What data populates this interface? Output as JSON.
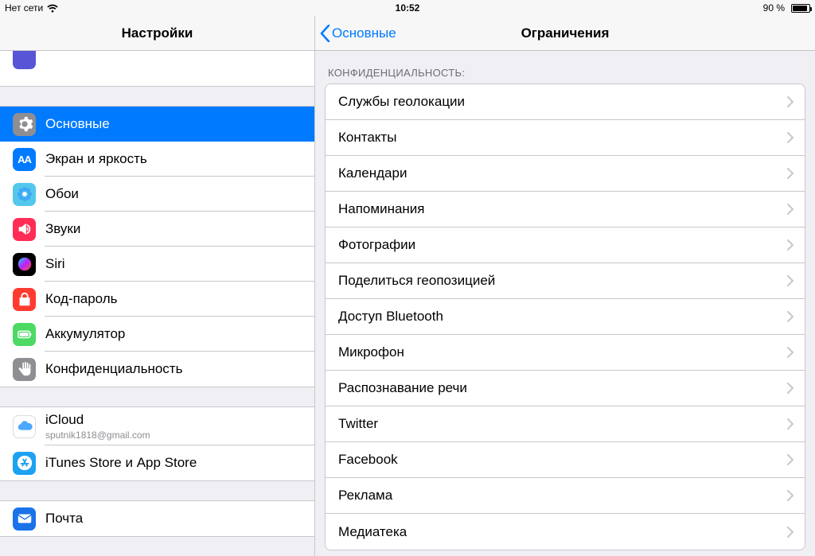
{
  "status": {
    "network": "Нет сети",
    "time": "10:52",
    "battery": "90 %"
  },
  "sidebar": {
    "title": "Настройки",
    "groups": [
      {
        "partial_top": {
          "icon_color": "#5856d6"
        },
        "items": []
      },
      {
        "items": [
          {
            "id": "general",
            "label": "Основные",
            "icon": "gear",
            "icon_bg": "#8e8e93",
            "selected": true
          },
          {
            "id": "display",
            "label": "Экран и яркость",
            "icon": "aa",
            "icon_bg": "#007aff"
          },
          {
            "id": "wallpaper",
            "label": "Обои",
            "icon": "flower",
            "icon_bg": "#54c7ec"
          },
          {
            "id": "sounds",
            "label": "Звуки",
            "icon": "speaker",
            "icon_bg": "#ff2d55"
          },
          {
            "id": "siri",
            "label": "Siri",
            "icon": "siri",
            "icon_bg": "#000000"
          },
          {
            "id": "passcode",
            "label": "Код-пароль",
            "icon": "lock",
            "icon_bg": "#ff3b30"
          },
          {
            "id": "battery",
            "label": "Аккумулятор",
            "icon": "battery",
            "icon_bg": "#4cd964"
          },
          {
            "id": "privacy",
            "label": "Конфиденциальность",
            "icon": "hand",
            "icon_bg": "#8e8e93"
          }
        ]
      },
      {
        "items": [
          {
            "id": "icloud",
            "label": "iCloud",
            "sub": "sputnik1818@gmail.com",
            "icon": "cloud",
            "icon_bg": "#ffffff",
            "icon_fg": "#4aa9ff"
          },
          {
            "id": "appstore",
            "label": "iTunes Store и App Store",
            "icon": "appstore",
            "icon_bg": "#1da1f2"
          }
        ]
      },
      {
        "items": [
          {
            "id": "mail",
            "label": "Почта",
            "icon": "mail",
            "icon_bg": "#1a73e8"
          }
        ]
      }
    ]
  },
  "detail": {
    "back_label": "Основные",
    "title": "Ограничения",
    "section_header": "КОНФИДЕНЦИАЛЬНОСТЬ:",
    "items": [
      {
        "id": "location",
        "label": "Службы геолокации"
      },
      {
        "id": "contacts",
        "label": "Контакты"
      },
      {
        "id": "calendars",
        "label": "Календари"
      },
      {
        "id": "reminders",
        "label": "Напоминания"
      },
      {
        "id": "photos",
        "label": "Фотографии"
      },
      {
        "id": "sharelocation",
        "label": "Поделиться геопозицией"
      },
      {
        "id": "bluetooth",
        "label": "Доступ Bluetooth"
      },
      {
        "id": "microphone",
        "label": "Микрофон"
      },
      {
        "id": "speech",
        "label": "Распознавание речи"
      },
      {
        "id": "twitter",
        "label": "Twitter"
      },
      {
        "id": "facebook",
        "label": "Facebook"
      },
      {
        "id": "ads",
        "label": "Реклама"
      },
      {
        "id": "media",
        "label": "Медиатека"
      }
    ]
  }
}
